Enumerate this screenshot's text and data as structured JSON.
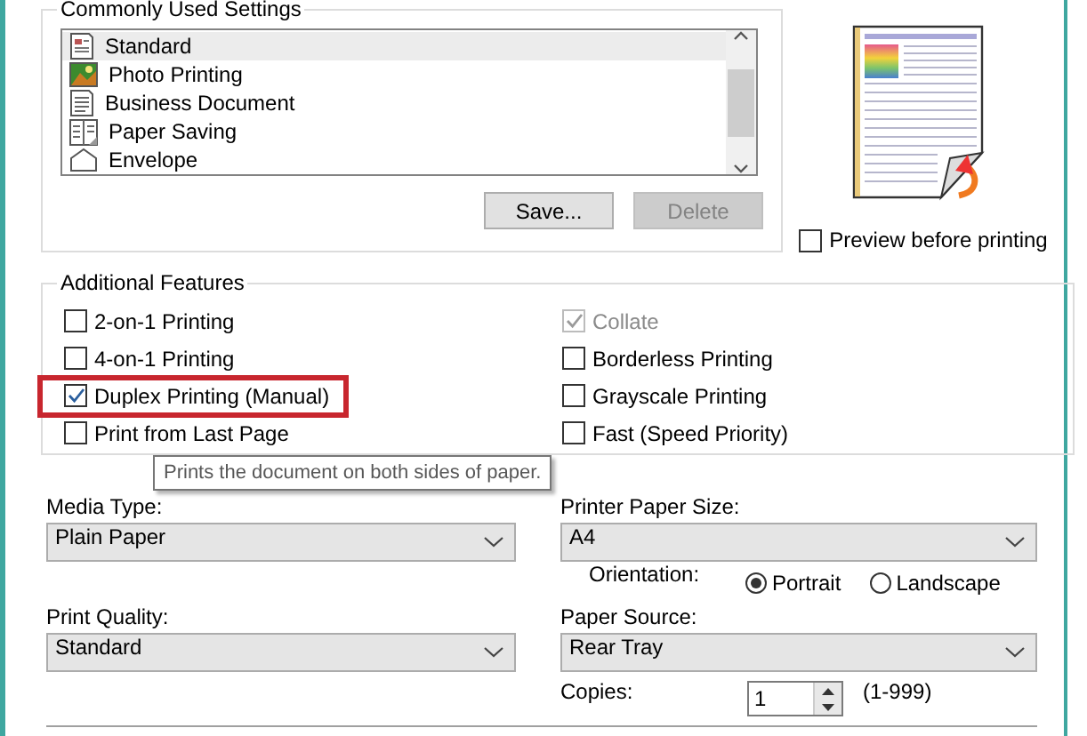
{
  "commonly_used_settings": {
    "legend": "Commonly Used Settings",
    "items": [
      {
        "label": "Standard",
        "kind": "standard",
        "selected": true
      },
      {
        "label": "Photo Printing",
        "kind": "photo",
        "selected": false
      },
      {
        "label": "Business Document",
        "kind": "document",
        "selected": false
      },
      {
        "label": "Paper Saving",
        "kind": "paper_saving",
        "selected": false
      },
      {
        "label": "Envelope",
        "kind": "envelope",
        "selected": false
      }
    ],
    "buttons": [
      {
        "label": "Save...",
        "disabled": false
      },
      {
        "label": "Delete",
        "disabled": true
      }
    ]
  },
  "preview": {
    "label": "Preview before printing",
    "checked": false
  },
  "additional_features": {
    "legend": "Additional Features",
    "items": [
      {
        "label": "2-on-1 Printing",
        "checked": false,
        "disabled": false,
        "highlighted": false
      },
      {
        "label": "Collate",
        "checked": true,
        "disabled": true,
        "highlighted": false
      },
      {
        "label": "4-on-1 Printing",
        "checked": false,
        "disabled": false,
        "highlighted": false
      },
      {
        "label": "Borderless Printing",
        "checked": false,
        "disabled": false,
        "highlighted": false
      },
      {
        "label": "Duplex Printing (Manual)",
        "checked": true,
        "disabled": false,
        "highlighted": true
      },
      {
        "label": "Grayscale Printing",
        "checked": false,
        "disabled": false,
        "highlighted": false
      },
      {
        "label": "Print from Last Page",
        "checked": false,
        "disabled": false,
        "highlighted": false
      },
      {
        "label": "Fast (Speed Priority)",
        "checked": false,
        "disabled": false,
        "highlighted": false
      }
    ],
    "tooltip": "Prints the document on both sides of paper."
  },
  "media_type": {
    "label": "Media Type:",
    "value": "Plain Paper"
  },
  "printer_paper_size": {
    "label": "Printer Paper Size:",
    "value": "A4"
  },
  "orientation": {
    "label": "Orientation:",
    "options": [
      {
        "label": "Portrait",
        "selected": true
      },
      {
        "label": "Landscape",
        "selected": false
      }
    ]
  },
  "print_quality": {
    "label": "Print Quality:",
    "value": "Standard"
  },
  "paper_source": {
    "label": "Paper Source:",
    "value": "Rear Tray"
  },
  "copies": {
    "label": "Copies:",
    "value": "1",
    "range": "(1-999)"
  }
}
